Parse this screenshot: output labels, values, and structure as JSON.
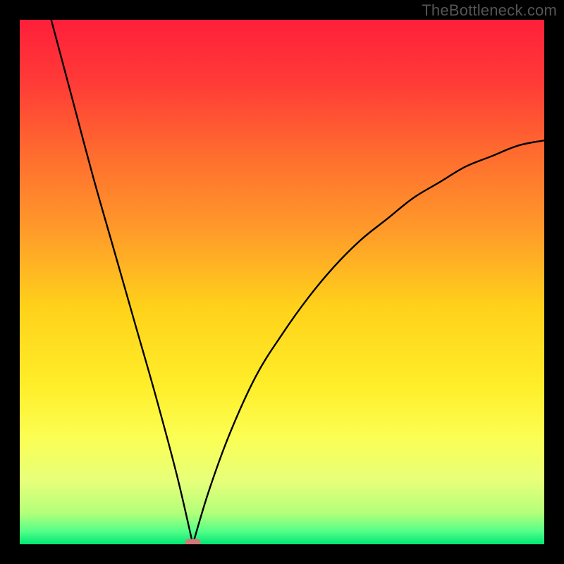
{
  "watermark": "TheBottleneck.com",
  "colors": {
    "background": "#000000",
    "gradient_stops": [
      {
        "offset": 0.0,
        "color": "#ff1f3a"
      },
      {
        "offset": 0.12,
        "color": "#ff3b37"
      },
      {
        "offset": 0.25,
        "color": "#ff6a2f"
      },
      {
        "offset": 0.4,
        "color": "#ff9a2a"
      },
      {
        "offset": 0.55,
        "color": "#ffd21a"
      },
      {
        "offset": 0.7,
        "color": "#ffee2a"
      },
      {
        "offset": 0.8,
        "color": "#fbff55"
      },
      {
        "offset": 0.88,
        "color": "#e6ff7a"
      },
      {
        "offset": 0.94,
        "color": "#b4ff7a"
      },
      {
        "offset": 0.975,
        "color": "#55ff88"
      },
      {
        "offset": 1.0,
        "color": "#00e874"
      }
    ],
    "curve": "#000000",
    "marker": "#d07a78"
  },
  "chart_data": {
    "type": "line",
    "title": "",
    "xlabel": "",
    "ylabel": "",
    "xlim": [
      0,
      100
    ],
    "ylim": [
      0,
      100
    ],
    "grid": false,
    "legend": false,
    "note": "V-shaped bottleneck curve; minimum near x≈33; left branch from y≈100 at x≈6 down to 0 at x≈33; right branch rises concavely to y≈77 at x=100. Values estimated from pixels.",
    "series": [
      {
        "name": "bottleneck-curve",
        "x": [
          6,
          10,
          14,
          18,
          22,
          26,
          30,
          33,
          36,
          40,
          45,
          50,
          55,
          60,
          65,
          70,
          75,
          80,
          85,
          90,
          95,
          100
        ],
        "y": [
          100,
          85,
          70,
          56,
          42,
          28,
          13,
          0,
          10,
          21,
          32,
          40,
          47,
          53,
          58,
          62,
          66,
          69,
          72,
          74,
          76,
          77
        ]
      }
    ],
    "marker": {
      "x": 33,
      "y": 0,
      "shape": "rounded-rect",
      "color": "#d07a78"
    }
  }
}
